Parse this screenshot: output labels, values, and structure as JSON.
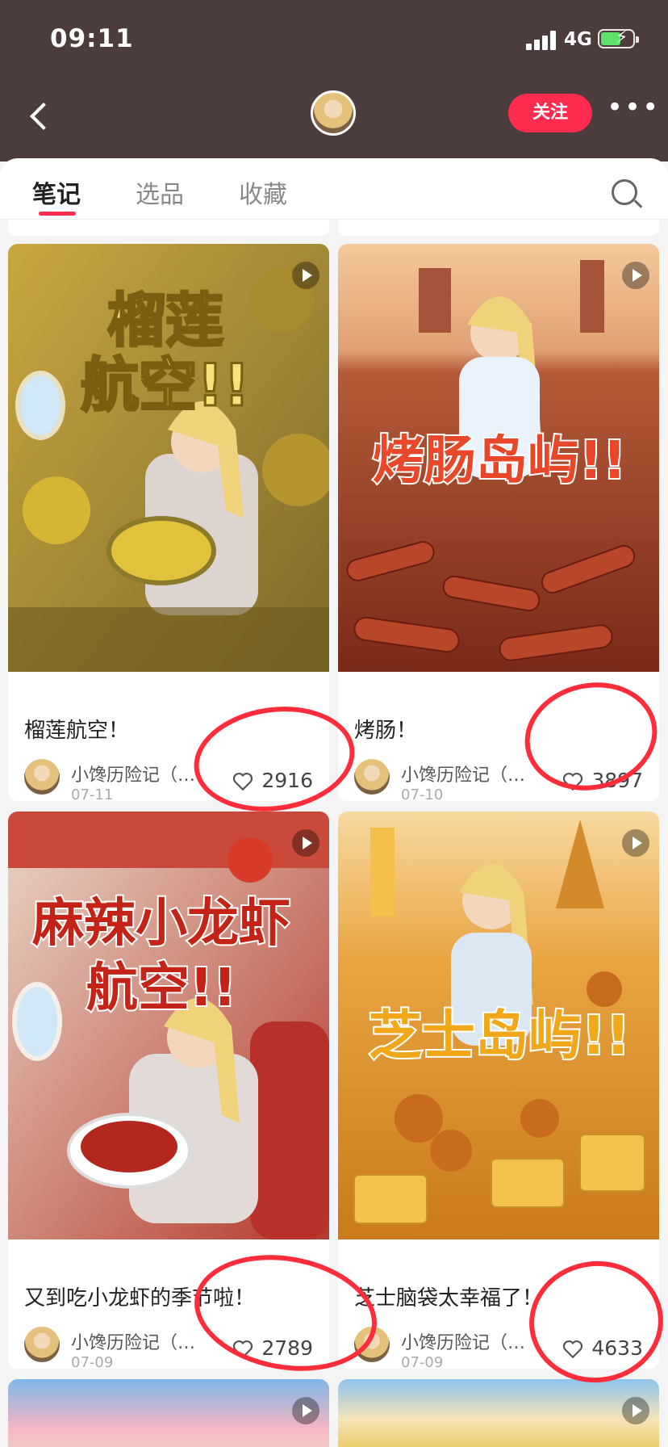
{
  "status": {
    "time": "09:11",
    "network": "4G"
  },
  "header": {
    "follow_label": "关注"
  },
  "tabs": [
    {
      "label": "笔记"
    },
    {
      "label": "选品"
    },
    {
      "label": "收藏"
    }
  ],
  "posts": [
    {
      "poster_text": "榴莲航空!!",
      "title": "榴莲航空！",
      "author": "小馋历险记（…",
      "date": "07-11",
      "likes": "2916"
    },
    {
      "poster_text": "烤肠岛屿!!",
      "title": "烤肠！",
      "author": "小馋历险记（…",
      "date": "07-10",
      "likes": "3897"
    },
    {
      "poster_text": "麻辣小龙虾航空!!",
      "title": "又到吃小龙虾的季节啦！",
      "author": "小馋历险记（…",
      "date": "07-09",
      "likes": "2789"
    },
    {
      "poster_text": "芝士岛屿!!",
      "title": "芝士脑袋太幸福了！",
      "author": "小馋历险记（…",
      "date": "07-09",
      "likes": "4633"
    }
  ],
  "colors": {
    "header_bg": "#4d3c3c",
    "accent": "#ff2c4f",
    "annotation": "#ff2d3a"
  }
}
